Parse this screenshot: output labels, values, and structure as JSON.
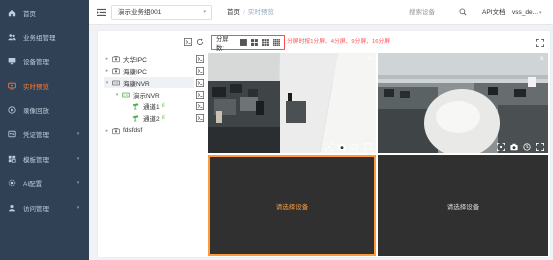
{
  "sidebar": {
    "items": [
      {
        "label": "首页",
        "icon": "home-icon",
        "arrow": ""
      },
      {
        "label": "业务组管理",
        "icon": "group-icon",
        "arrow": ""
      },
      {
        "label": "设备管理",
        "icon": "device-icon",
        "arrow": ""
      },
      {
        "label": "实时预览",
        "icon": "monitor-icon",
        "arrow": "",
        "active": true
      },
      {
        "label": "录像回放",
        "icon": "playback-icon",
        "arrow": ""
      },
      {
        "label": "凭证管理",
        "icon": "credential-icon",
        "arrow": "▾"
      },
      {
        "label": "模板管理",
        "icon": "template-icon",
        "arrow": "▾"
      },
      {
        "label": "AI配置",
        "icon": "ai-icon",
        "arrow": "▾"
      },
      {
        "label": "访问管理",
        "icon": "access-icon",
        "arrow": "▾"
      }
    ],
    "active_color": "#ff7a2e"
  },
  "header": {
    "business_group": "演示业务组001",
    "breadcrumb_home": "首页",
    "breadcrumb_sep": "/",
    "breadcrumb_current": "实时预览",
    "search_placeholder": "搜索设备",
    "api_docs": "API文档",
    "user": "vss_de..."
  },
  "tree": {
    "nodes": [
      {
        "label": "大华IPC",
        "toggle": "▸",
        "icon": "camera-folder-icon",
        "level": 0
      },
      {
        "label": "海康IPC",
        "toggle": "▸",
        "icon": "camera-folder-icon",
        "level": 0
      },
      {
        "label": "海康NVR",
        "toggle": "▾",
        "icon": "nvr-icon",
        "level": 0
      },
      {
        "label": "演示NVR",
        "toggle": "▾",
        "icon": "nvr-channel-icon",
        "level": 1
      },
      {
        "label": "通道1",
        "toggle": "",
        "icon": "camera-icon",
        "level": 2,
        "signal": "ıl"
      },
      {
        "label": "通道2",
        "toggle": "",
        "icon": "camera-icon",
        "level": 2,
        "signal": "ıl"
      },
      {
        "label": "fdsfdsf",
        "toggle": "▸",
        "icon": "camera-folder-icon",
        "level": 0
      }
    ]
  },
  "split": {
    "label": "分屏数:",
    "options": [
      "1",
      "4",
      "9",
      "16"
    ],
    "hint": "分屏时按1分屏、4分屏、9分屏、16分屏"
  },
  "player": {
    "cells": [
      {
        "state": "playing",
        "scene": "office-cam-1",
        "close": "×"
      },
      {
        "state": "playing",
        "scene": "office-cam-2",
        "close": "×"
      },
      {
        "state": "empty",
        "text": "请选择设备",
        "selected": true
      },
      {
        "state": "empty",
        "text": "请选择设备",
        "selected": false
      }
    ],
    "selected_color": "#ff9a3c"
  }
}
